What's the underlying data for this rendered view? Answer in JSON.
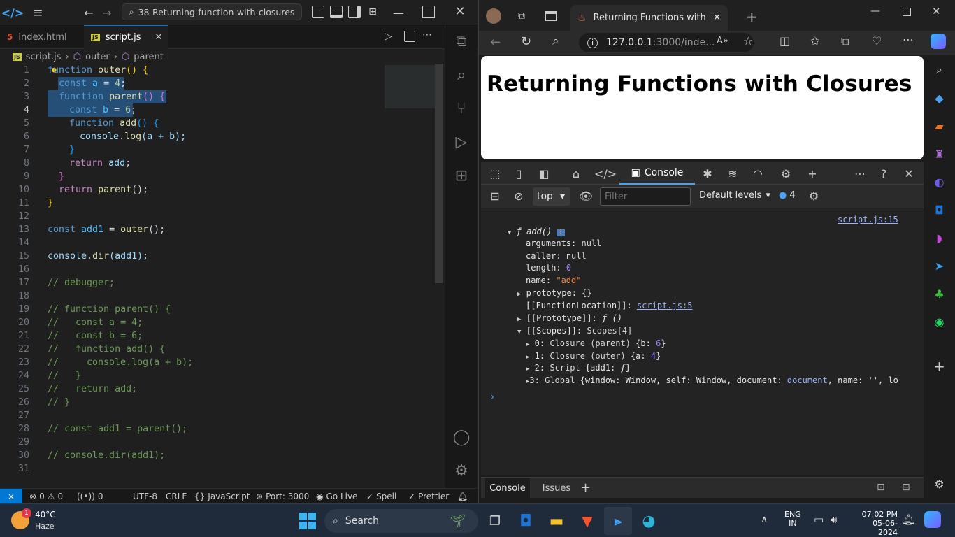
{
  "vscode": {
    "search_text": "38-Returning-function-with-closures",
    "tabs": [
      {
        "label": "index.html",
        "icon": "html5-icon"
      },
      {
        "label": "script.js",
        "icon": "js-icon"
      }
    ],
    "breadcrumb": [
      "script.js",
      "outer",
      "parent"
    ],
    "line_numbers": [
      "1",
      "2",
      "3",
      "4",
      "5",
      "6",
      "7",
      "8",
      "9",
      "10",
      "11",
      "12",
      "13",
      "14",
      "15",
      "16",
      "17",
      "18",
      "19",
      "20",
      "21",
      "22",
      "23",
      "24",
      "25",
      "26",
      "27",
      "28",
      "29",
      "30",
      "31"
    ],
    "lines": [
      {
        "kw": "function",
        "fn": "outer",
        "rest": "() {"
      },
      {
        "kw": "const",
        "var": "a",
        "rest": " = ",
        "num": "4",
        "end": ";"
      },
      {
        "kw": "function",
        "fn": "parent",
        "rest": "() {"
      },
      {
        "kw": "const",
        "var": "b",
        "rest": " = ",
        "num": "6",
        "end": ";"
      },
      {
        "kw": "function",
        "fn": "add",
        "rest": "() {"
      },
      {
        "obj": "console",
        "fn": "log",
        "args": "(a + b);"
      },
      {
        "close": "}"
      },
      {
        "kw": "return",
        "var": "add",
        "end": ";"
      },
      {
        "close": "}"
      },
      {
        "kw": "return",
        "fn": "parent",
        "rest": "();"
      },
      {
        "close": "}"
      },
      {},
      {
        "kw": "const",
        "var": "add1",
        "rest": " = ",
        "fn": "outer",
        "end": "();"
      },
      {},
      {
        "obj": "console",
        "fn": "dir",
        "args": "(add1);"
      },
      {},
      {
        "comment": "// debugger;"
      },
      {},
      {
        "comment": "// function parent() {"
      },
      {
        "comment": "//   const a = 4;"
      },
      {
        "comment": "//   const b = 6;"
      },
      {
        "comment": "//   function add() {"
      },
      {
        "comment": "//     console.log(a + b);"
      },
      {
        "comment": "//   }"
      },
      {
        "comment": "//   return add;"
      },
      {
        "comment": "// }"
      },
      {},
      {
        "comment": "// const add1 = parent();"
      },
      {},
      {
        "comment": "// console.dir(add1);"
      },
      {}
    ],
    "status": {
      "errors": "0",
      "warnings": "0",
      "ports": "0",
      "encoding": "UTF-8",
      "eol": "CRLF",
      "language": "JavaScript",
      "port": "Port: 3000",
      "golive": "Go Live",
      "spell": "Spell",
      "prettier": "Prettier"
    }
  },
  "edge": {
    "tab_title": "Returning Functions with Closure",
    "url_host": "127.0.0.1",
    "url_rest": ":3000/inde...",
    "page_heading": "Returning Functions with Closures",
    "devtools": {
      "console_tab": "Console",
      "context": "top",
      "filter_placeholder": "Filter",
      "levels": "Default levels",
      "issue_count": "4",
      "source_link": "script.js:15",
      "entries": {
        "fn_header": "add()",
        "arguments": [
          "arguments",
          "null"
        ],
        "caller": [
          "caller",
          "null"
        ],
        "length": [
          "length",
          "0"
        ],
        "name": [
          "name",
          "\"add\""
        ],
        "prototype": [
          "prototype",
          "{}"
        ],
        "location_key": "[[FunctionLocation]]",
        "location_val": "script.js:5",
        "proto_key": "[[Prototype]]",
        "proto_val": "ƒ ()",
        "scopes_key": "[[Scopes]]",
        "scopes_val": "Scopes[4]",
        "scope0": [
          "0:",
          "Closure (parent)",
          "{b: ",
          "6",
          "}"
        ],
        "scope1": [
          "1:",
          "Closure (outer)",
          "{a: ",
          "4",
          "}"
        ],
        "scope2": [
          "2:",
          "Script",
          "{add1: ",
          "ƒ",
          "}"
        ],
        "scope3": [
          "3:",
          "Global",
          "{window: Window, self: Window, document: ",
          "document",
          ", name: '', lo"
        ]
      },
      "drawer_tabs": [
        "Console",
        "Issues"
      ]
    }
  },
  "taskbar": {
    "weather_temp": "40°C",
    "weather_desc": "Haze",
    "weather_badge": "1",
    "search_label": "Search",
    "lang_top": "ENG",
    "lang_bottom": "IN",
    "time": "07:02 PM",
    "date": "05-06-2024"
  },
  "colors": {
    "accent": "#0078d4",
    "vscode_blue": "#007acc",
    "selection": "#264f78"
  }
}
